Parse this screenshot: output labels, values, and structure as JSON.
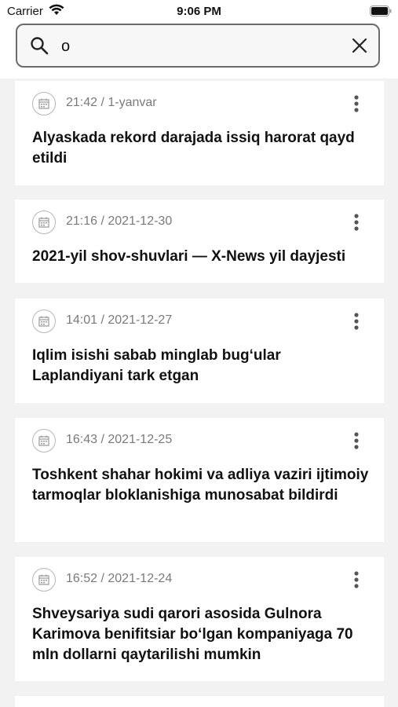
{
  "status": {
    "carrier": "Carrier",
    "time": "9:06 PM"
  },
  "search": {
    "value": "o",
    "placeholder": ""
  },
  "news": [
    {
      "date": "21:42 / 1-yanvar",
      "title": "Alyaskada rekord darajada issiq harorat qayd etildi"
    },
    {
      "date": "21:16 / 2021-12-30",
      "title": "2021-yil shov-shuvlari — X-News yil dayjesti"
    },
    {
      "date": "14:01 / 2021-12-27",
      "title": "Iqlim isishi sabab minglab bug‘ular Laplandiyani tark etgan"
    },
    {
      "date": "16:43 / 2021-12-25",
      "title": "Toshkent shahar hokimi va adliya vaziri ijtimoiy tarmoqlar bloklanishiga munosabat bildirdi"
    },
    {
      "date": "16:52 / 2021-12-24",
      "title": "Shveysariya sudi qarori asosida Gulnora Karimova benifitsiar bo‘lgan kompaniyaga 70 mln dollarni qaytarilishi mumkin"
    }
  ]
}
